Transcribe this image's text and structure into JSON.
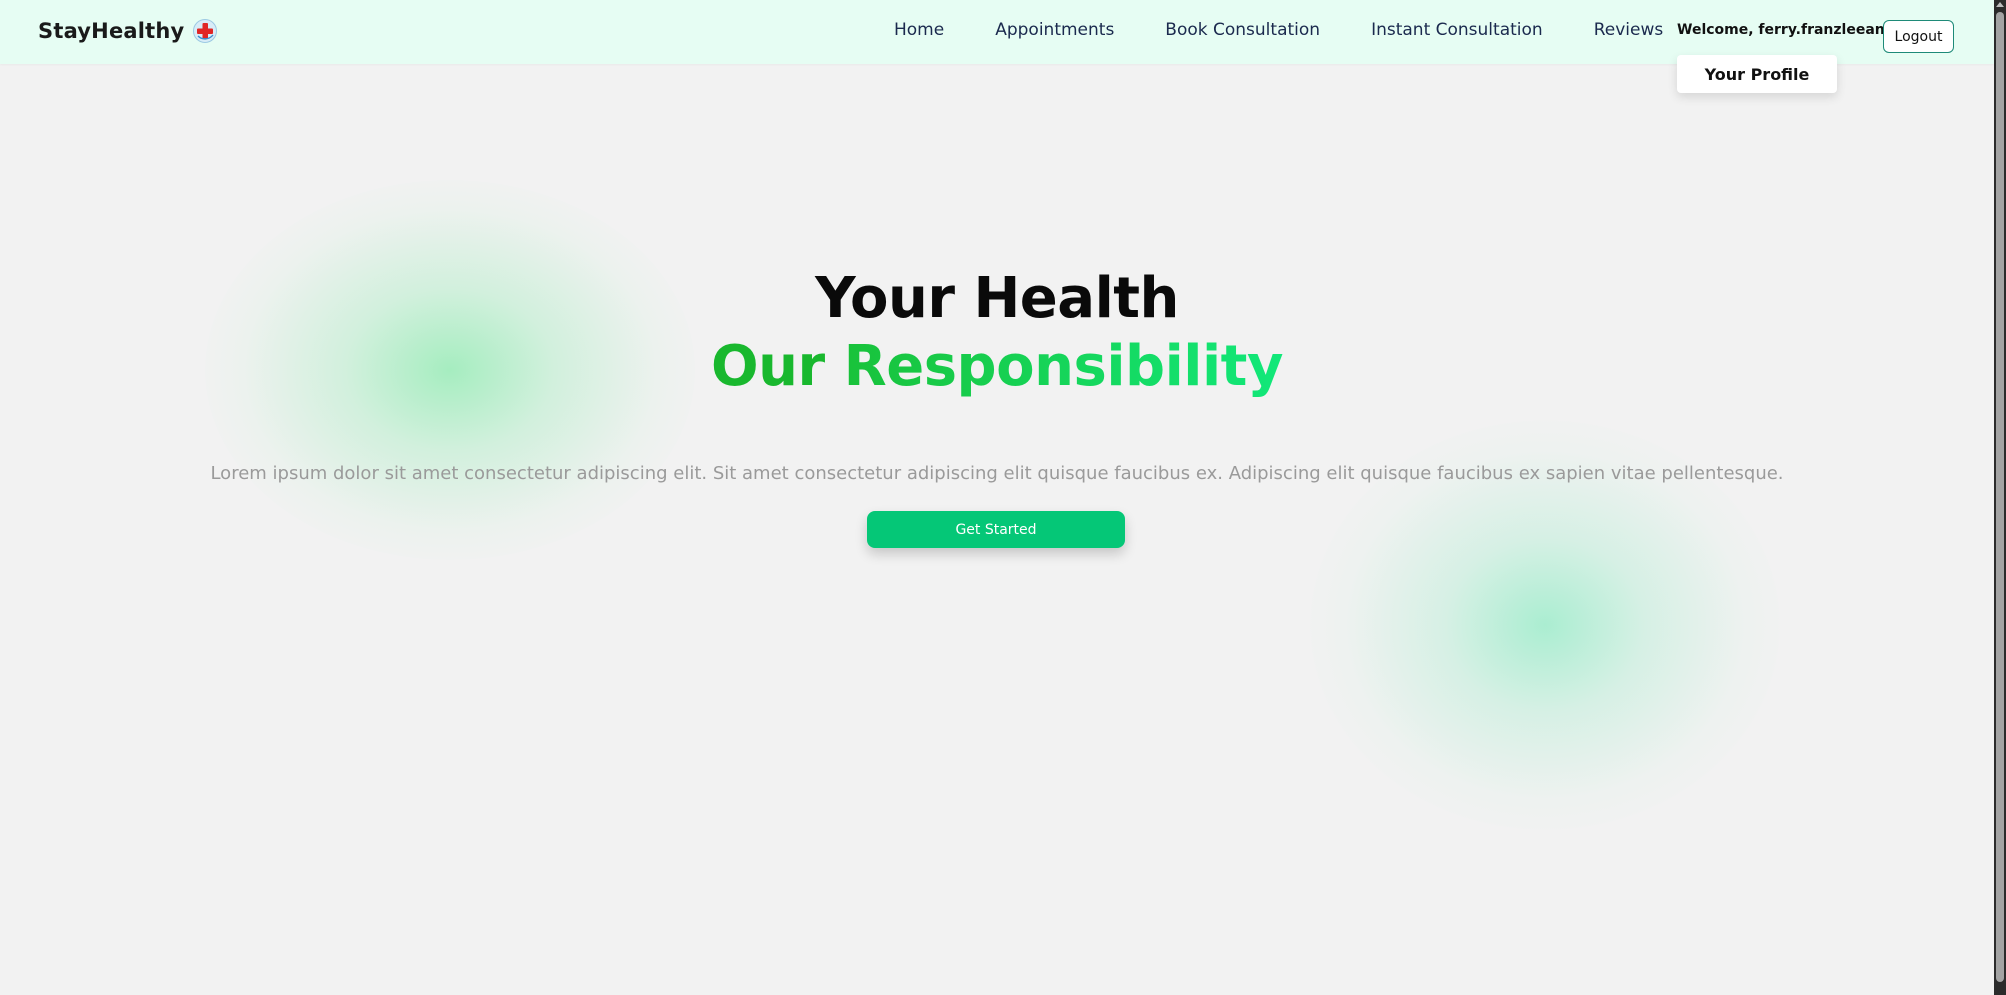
{
  "navbar": {
    "brand": "StayHealthy",
    "brand_icon": "medical-cross-icon",
    "links": [
      {
        "label": "Home"
      },
      {
        "label": "Appointments"
      },
      {
        "label": "Book Consultation"
      },
      {
        "label": "Instant Consultation"
      },
      {
        "label": "Reviews"
      }
    ],
    "welcome": "Welcome, ferry.franzleeann",
    "logout": "Logout",
    "dropdown": {
      "profile": "Your Profile"
    }
  },
  "hero": {
    "title": "Your Health",
    "subtitle_word1": "Our",
    "subtitle_word2": "Responsibility",
    "description": "Lorem ipsum dolor sit amet consectetur adipiscing elit. Sit amet consectetur adipiscing elit quisque faucibus ex. Adipiscing elit quisque faucibus ex sapien vitae pellentesque.",
    "cta": "Get Started"
  },
  "colors": {
    "navbar_bg": "#e6fdf3",
    "accent_green": "#19b82e",
    "cta_green": "#05c777",
    "page_bg": "#f2f2f2"
  }
}
